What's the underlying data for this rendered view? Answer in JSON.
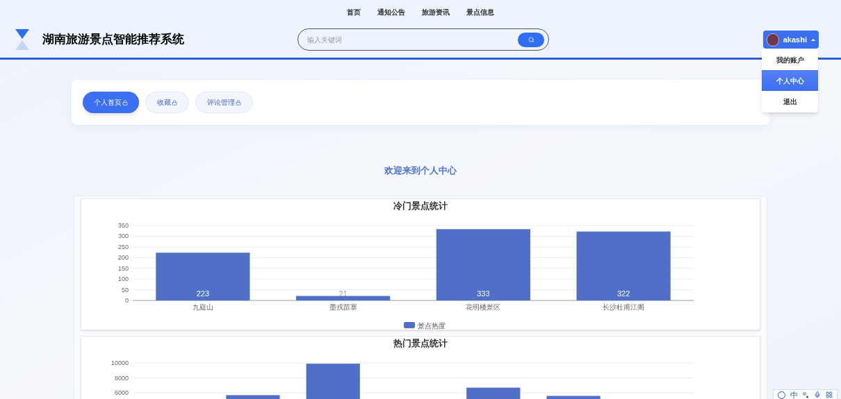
{
  "top_nav": [
    {
      "label": "首页"
    },
    {
      "label": "通知公告"
    },
    {
      "label": "旅游资讯"
    },
    {
      "label": "景点信息"
    }
  ],
  "header": {
    "title": "湖南旅游景点智能推荐系统",
    "search": {
      "placeholder": "输入关键词"
    },
    "user": {
      "name": "akashi"
    }
  },
  "user_menu": [
    {
      "label": "我的账户",
      "selected": false
    },
    {
      "label": "个人中心",
      "selected": true
    },
    {
      "label": "退出",
      "selected": false
    }
  ],
  "tabs": [
    {
      "label": "个人首页",
      "selected": true
    },
    {
      "label": "收藏",
      "selected": false
    },
    {
      "label": "评论管理",
      "selected": false
    }
  ],
  "welcome": "欢迎来到个人中心",
  "charts": [
    {
      "chart_data": {
        "type": "bar",
        "title": "冷门景点统计",
        "categories": [
          "九嶷山",
          "墨戎苗寨",
          "花明楼景区",
          "长沙杜甫江阁"
        ],
        "series": [
          {
            "name": "景点热度",
            "color": "#5070c8",
            "values": [
              223,
              21,
              333,
              322
            ]
          }
        ],
        "ylim": [
          0,
          350
        ],
        "yticks": [
          0,
          50,
          100,
          150,
          200,
          250,
          300,
          350
        ],
        "grid": true,
        "data_labels": true
      }
    },
    {
      "chart_data": {
        "type": "bar",
        "title": "热门景点统计",
        "series": [
          {
            "color": "#5070c8",
            "values": [
              null,
              5700,
              9900,
              null,
              6700,
              5600,
              null
            ]
          }
        ],
        "ylim": [
          0,
          10000
        ],
        "yticks": [
          6000,
          8000,
          10000
        ],
        "grid": true
      }
    }
  ],
  "ime_toolbar": {
    "mode": "中"
  }
}
